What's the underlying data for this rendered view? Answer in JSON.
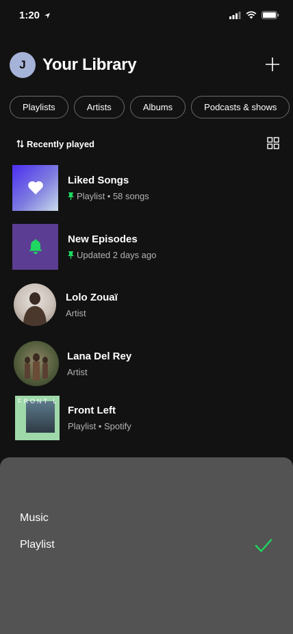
{
  "status": {
    "time": "1:20"
  },
  "header": {
    "avatar_initial": "J",
    "title": "Your Library"
  },
  "filters": [
    "Playlists",
    "Artists",
    "Albums",
    "Podcasts & shows"
  ],
  "sort": {
    "label": "Recently played"
  },
  "items": [
    {
      "title": "Liked Songs",
      "subtitle": "Playlist • 58 songs",
      "pinned": true
    },
    {
      "title": "New Episodes",
      "subtitle": "Updated 2 days ago",
      "pinned": true
    },
    {
      "title": "Lolo Zouaï",
      "subtitle": "Artist",
      "pinned": false
    },
    {
      "title": "Lana Del Rey",
      "subtitle": "Artist",
      "pinned": false
    },
    {
      "title": "Front Left",
      "subtitle": "Playlist • Spotify",
      "pinned": false
    }
  ],
  "front_left_cover_text": "FRONT LEFT",
  "sheet": {
    "options": [
      "Music",
      "Playlist"
    ],
    "selected": "Playlist"
  },
  "colors": {
    "accent": "#1ed760",
    "background": "#121212",
    "sheet": "#535353"
  }
}
